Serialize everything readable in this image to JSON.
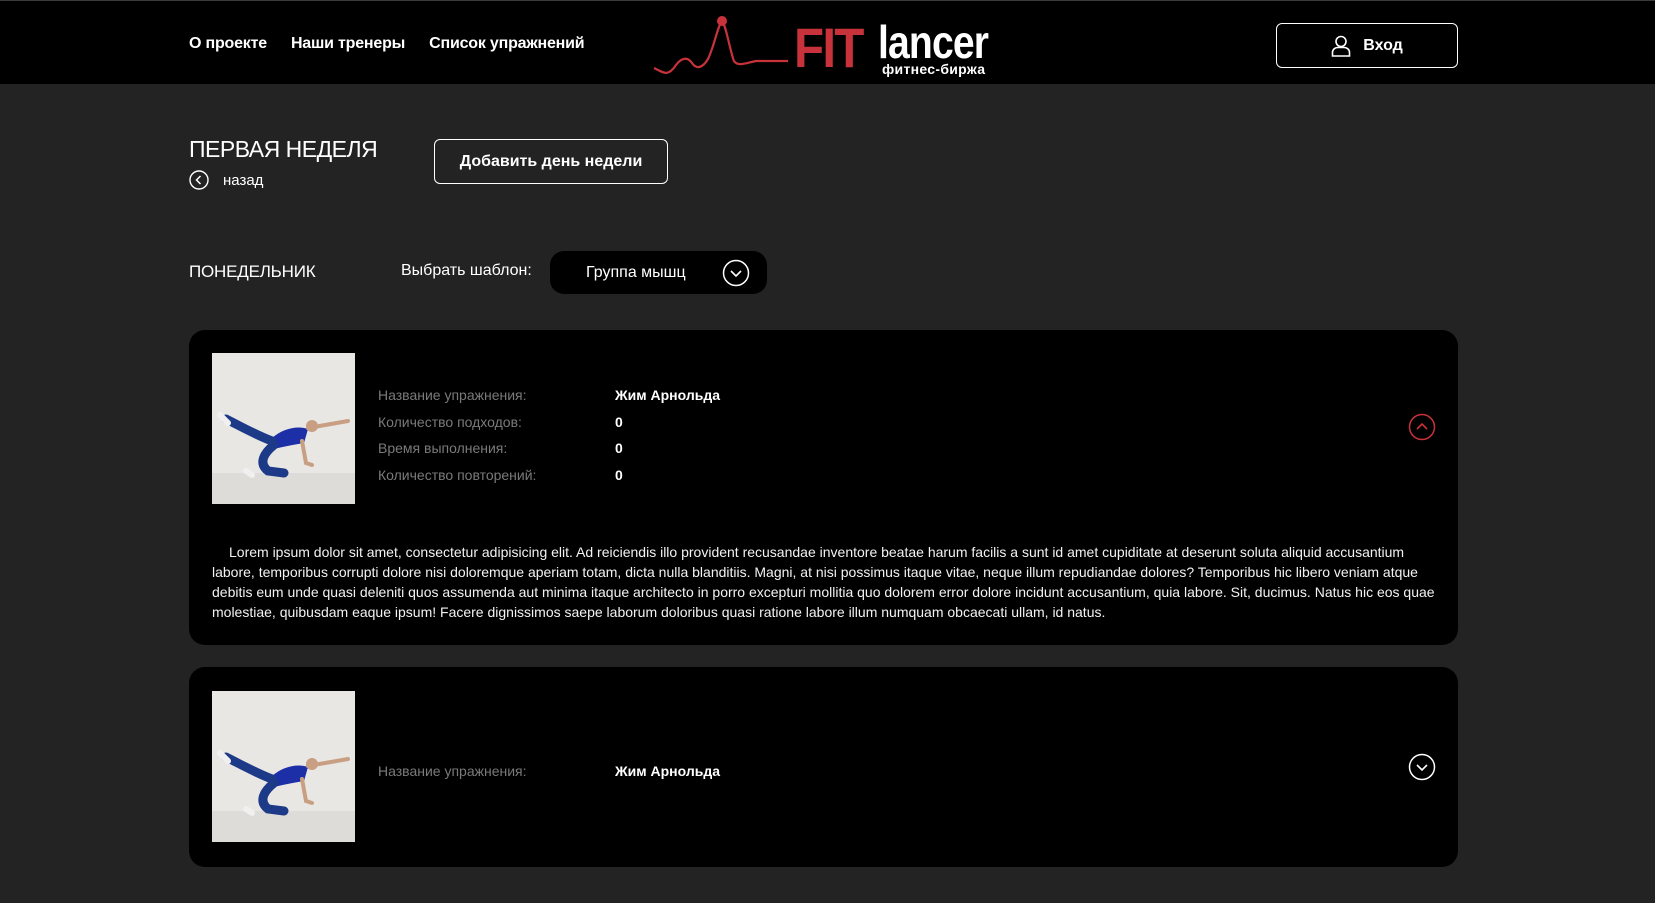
{
  "header": {
    "nav": [
      "О проекте",
      "Наши тренеры",
      "Список упражнений"
    ],
    "logo": {
      "fit": "FIT",
      "lancer": "lancer",
      "subtitle": "фитнес-биржа"
    },
    "login_label": "Вход"
  },
  "page": {
    "title": "ПЕРВАЯ НЕДЕЛЯ",
    "back_label": "назад",
    "add_day_label": "Добавить день недели",
    "day_label": "ПОНЕДЕЛЬНИК",
    "template_label": "Выбрать шаблон:",
    "template_value": "Группа мышц"
  },
  "exercises": [
    {
      "fields": [
        {
          "label": "Название упражнения:",
          "value": "Жим Арнольда"
        },
        {
          "label": "Количество подходов:",
          "value": "0"
        },
        {
          "label": "Время выполнения:",
          "value": "0"
        },
        {
          "label": "Количество повторений:",
          "value": "0"
        }
      ],
      "expanded": true,
      "description": "Lorem ipsum dolor sit amet, consectetur adipisicing elit. Ad reiciendis illo provident recusandae inventore beatae harum facilis a sunt id amet cupiditate at deserunt soluta aliquid accusantium labore, temporibus corrupti dolore nisi doloremque aperiam totam, dicta nulla blanditiis. Magni, at nisi possimus itaque vitae, neque illum repudiandae dolores? Temporibus hic libero veniam atque debitis eum unde quasi deleniti quos assumenda aut minima itaque architecto in porro excepturi mollitia quo dolorem error dolore incidunt accusantium, quia labore. Sit, ducimus. Natus hic eos quae molestiae, quibusdam eaque ipsum! Facere dignissimos saepe laborum doloribus quasi ratione labore illum numquam obcaecati ullam, id natus."
    },
    {
      "fields": [
        {
          "label": "Название упражнения:",
          "value": "Жим Арнольда"
        }
      ],
      "expanded": false
    }
  ],
  "colors": {
    "accent": "#c8323a",
    "background": "#232323",
    "panel": "#000000"
  }
}
